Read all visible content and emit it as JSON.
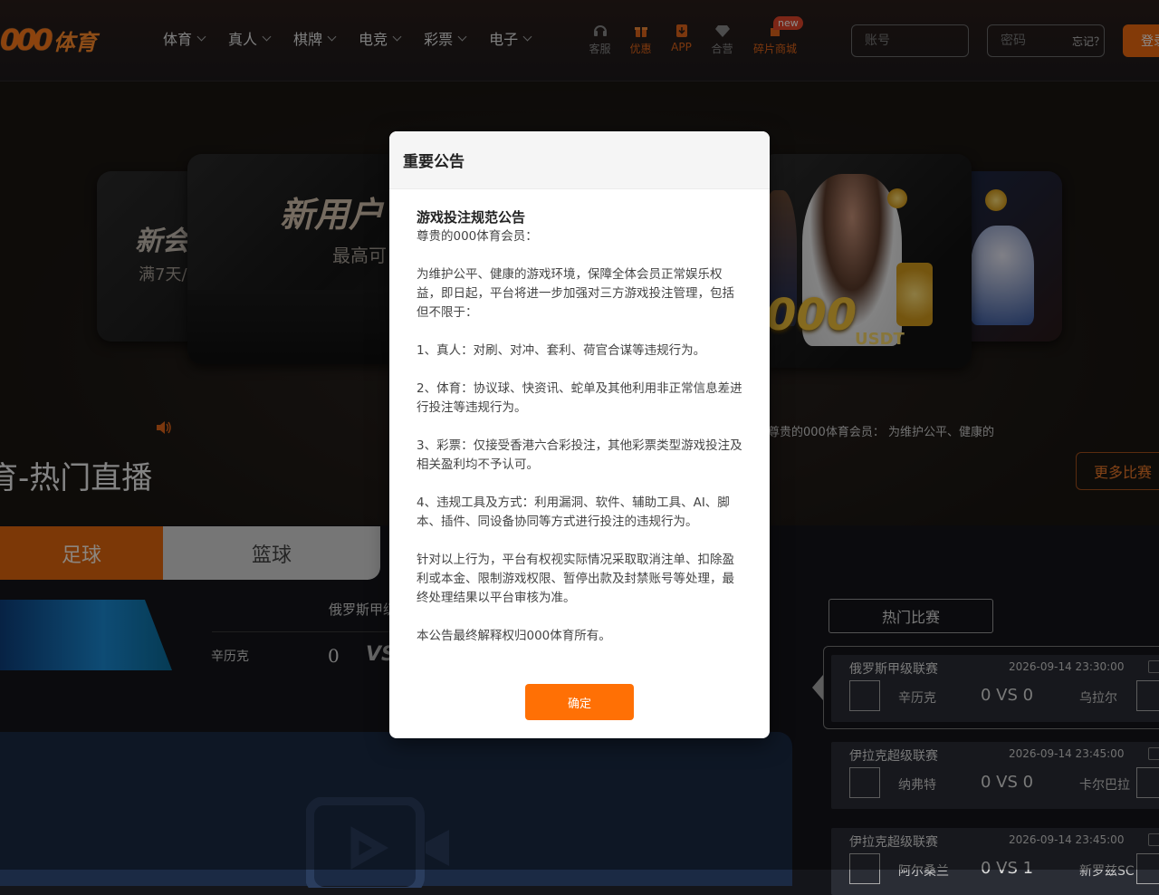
{
  "header": {
    "logo_mark": "000",
    "logo_text": "体育",
    "nav": [
      {
        "label": "体育"
      },
      {
        "label": "真人"
      },
      {
        "label": "棋牌"
      },
      {
        "label": "电竞"
      },
      {
        "label": "彩票"
      },
      {
        "label": "电子"
      }
    ],
    "quick": [
      {
        "label": "客服",
        "icon": "headset-icon",
        "color": "#8a8a8a"
      },
      {
        "label": "优惠",
        "icon": "gift-icon",
        "color": "#e0651a"
      },
      {
        "label": "APP",
        "icon": "download-icon",
        "color": "#e0651a"
      },
      {
        "label": "合营",
        "icon": "diamond-icon",
        "color": "#8a8a8a"
      },
      {
        "label": "碎片商城",
        "icon": "puzzle-icon",
        "color": "#e0651a",
        "badge": "new"
      }
    ],
    "account_placeholder": "账号",
    "password_placeholder": "密码",
    "forgot_label": "忘记？",
    "login_label": "登录"
  },
  "banner": {
    "slide_left_title": "新会",
    "slide_left_sub": "满7天/",
    "slide_center_title": "新用户",
    "slide_center_sub": "最高可",
    "slide_right_amount": "000",
    "slide_right_unit": "USDT"
  },
  "marquee_text": "尊贵的000体育会员： 为维护公平、健康的",
  "live": {
    "title": "育-热门直播",
    "more_label": "更多比赛",
    "tabs": [
      {
        "label": "足球",
        "active": true
      },
      {
        "label": "篮球",
        "active": false
      }
    ],
    "featured": {
      "league": "俄罗斯甲级",
      "home": "辛历克",
      "home_score": "0",
      "vs": "VS"
    }
  },
  "hot": {
    "title": "热门比赛",
    "matches": [
      {
        "league": "俄罗斯甲级联赛",
        "time": "2026-09-14 23:30:00",
        "home": "辛历克",
        "score": "0 VS 0",
        "away": "乌拉尔"
      },
      {
        "league": "伊拉克超级联赛",
        "time": "2026-09-14 23:45:00",
        "home": "纳弗特",
        "score": "0 VS 0",
        "away": "卡尔巴拉"
      },
      {
        "league": "伊拉克超级联赛",
        "time": "2026-09-14 23:45:00",
        "home": "阿尔桑兰",
        "score": "0 VS 1",
        "away": "新罗兹SC"
      }
    ]
  },
  "modal": {
    "header": "重要公告",
    "notice_title": "游戏投注规范公告",
    "greeting": "尊贵的000体育会员：",
    "intro": "为维护公平、健康的游戏环境，保障全体会员正常娱乐权益，即日起，平台将进一步加强对三方游戏投注管理，包括但不限于：",
    "items": [
      "1、真人：对刷、对冲、套利、荷官合谋等违规行为。",
      "2、体育：协议球、快资讯、蛇单及其他利用非正常信息差进行投注等违规行为。",
      "3、彩票：仅接受香港六合彩投注，其他彩票类型游戏投注及相关盈利均不予认可。",
      "4、违规工具及方式：利用漏洞、软件、辅助工具、AI、脚本、插件、同设备协同等方式进行投注的违规行为。"
    ],
    "action": "针对以上行为，平台有权视实际情况采取取消注单、扣除盈利或本金、限制游戏权限、暂停出款及封禁账号等处理，最终处理结果以平台审核为准。",
    "footer": "本公告最终解释权归000体育所有。",
    "confirm_label": "确定"
  }
}
